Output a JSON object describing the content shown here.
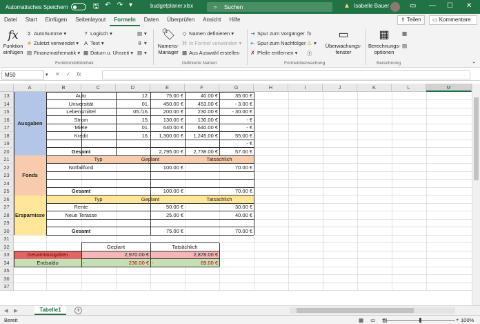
{
  "titlebar": {
    "autosave_label": "Automatisches Speichern",
    "filename": "budgetplaner.xlsx",
    "search_placeholder": "Suchen",
    "user_name": "Isabelle Bauer",
    "icons": [
      "save-icon",
      "undo-icon",
      "redo-icon"
    ]
  },
  "tabs": [
    "Datei",
    "Start",
    "Einfügen",
    "Seitenlayout",
    "Formeln",
    "Daten",
    "Überprüfen",
    "Ansicht",
    "Hilfe"
  ],
  "active_tab": "Formeln",
  "share_label": "Teilen",
  "comments_label": "Kommentare",
  "ribbon": {
    "insert_function_label": "Funktion einfügen",
    "autosum": "AutoSumme",
    "recent": "Zuletzt verwendet",
    "financial": "Finanzmathematik",
    "logical": "Logisch",
    "text": "Text",
    "datetime": "Datum u. Uhrzeit",
    "group_library": "Funktionsbibliothek",
    "name_manager": "Namens-Manager",
    "define_name": "Namen definieren",
    "use_in_formula": "In Formel verwenden",
    "create_from_selection": "Aus Auswahl erstellen",
    "group_names": "Definierte Namen",
    "trace_precedents": "Spur zum Vorgänger",
    "trace_dependents": "Spur zum Nachfolger",
    "remove_arrows": "Pfeile entfernen",
    "watch_window": "Überwachungs-fenster",
    "group_audit": "Formelüberwachung",
    "calc_options": "Berechnungs-optionen",
    "group_calc": "Berechnung"
  },
  "formula_bar": {
    "name_box": "M50",
    "fx": "fx",
    "content": ""
  },
  "columns": [
    "A",
    "B",
    "C",
    "D",
    "E",
    "F",
    "G",
    "H",
    "I",
    "J",
    "K",
    "L",
    "M"
  ],
  "rows": [
    "13",
    "14",
    "15",
    "16",
    "17",
    "18",
    "19",
    "20",
    "21",
    "22",
    "23",
    "24",
    "25",
    "26",
    "27",
    "28",
    "29",
    "30",
    "31",
    "32",
    "33",
    "34",
    "35",
    "36",
    "37"
  ],
  "ausgaben": {
    "label": "Ausgaben",
    "items": [
      {
        "name": "Auto",
        "date": "12.",
        "plan": "75.00 €",
        "actual": "40.00 €",
        "diff": "35.00 €"
      },
      {
        "name": "Universität",
        "date": "01.",
        "plan": "450.00 €",
        "actual": "453.00 €",
        "diff": "-   3.00 €"
      },
      {
        "name": "Lebensmittel",
        "date": "05./16.",
        "plan": "200.00 €",
        "actual": "230.00 €",
        "diff": "-   30.00 €"
      },
      {
        "name": "Strom",
        "date": "15.",
        "plan": "130.00 €",
        "actual": "130.00 €",
        "diff": "-     €"
      },
      {
        "name": "Miete",
        "date": "01.",
        "plan": "640.00 €",
        "actual": "640.00 €",
        "diff": "-     €"
      },
      {
        "name": "Kredit",
        "date": "16.",
        "plan": "1,300.00 €",
        "actual": "1,245.00 €",
        "diff": "55.00 €"
      },
      {
        "name": "",
        "date": "",
        "plan": "",
        "actual": "",
        "diff": "-     €"
      }
    ],
    "total_label": "Gesamt",
    "total_plan": "2,795.00 €",
    "total_actual": "2,738.00 €",
    "total_diff": "57.00 €"
  },
  "fonds": {
    "label": "Fonds",
    "header_type": "Typ",
    "header_plan": "Geplant",
    "header_actual": "Tatsächlich",
    "items": [
      {
        "name": "Notfallfond",
        "plan": "100.00 €",
        "actual": "70.00 €"
      }
    ],
    "total_label": "Gesamt",
    "total_plan": "100.00 €",
    "total_actual": "70.00 €"
  },
  "ersparnisse": {
    "label": "Ersparnisse",
    "header_type": "Typ",
    "header_plan": "Geplant",
    "header_actual": "Tatsächlich",
    "items": [
      {
        "name": "Rente",
        "plan": "50.00 €",
        "actual": "30.00 €"
      },
      {
        "name": "Neue Terasse",
        "plan": "25.00 €",
        "actual": "40.00 €"
      }
    ],
    "total_label": "Gesamt",
    "total_plan": "75.00 €",
    "total_actual": "70.00 €"
  },
  "summary": {
    "header_plan": "Geplant",
    "header_actual": "Tatsächlich",
    "expenses_label": "Gesamtausgaben",
    "expenses_plan": "2,970.00 €",
    "expenses_actual": "2,878.00 €",
    "balance_label": "Endsaldo",
    "balance_plan_sign": "-",
    "balance_plan": "236.00 €",
    "balance_actual_sign": "-",
    "balance_actual": "69.00 €"
  },
  "sheet_tab": "Tabelle1",
  "status": {
    "ready": "Bereit",
    "zoom": "100%"
  },
  "colors": {
    "excel_green": "#217346",
    "ausgaben_fill": "#b4c6e7",
    "fonds_fill": "#f8cbad",
    "ersparnisse_fill": "#ffe699",
    "expenses_fill": "#f4b6b6",
    "expenses_label_fill": "#e06666",
    "balance_fill": "#c5e0b4",
    "negative_text": "#c00000"
  }
}
